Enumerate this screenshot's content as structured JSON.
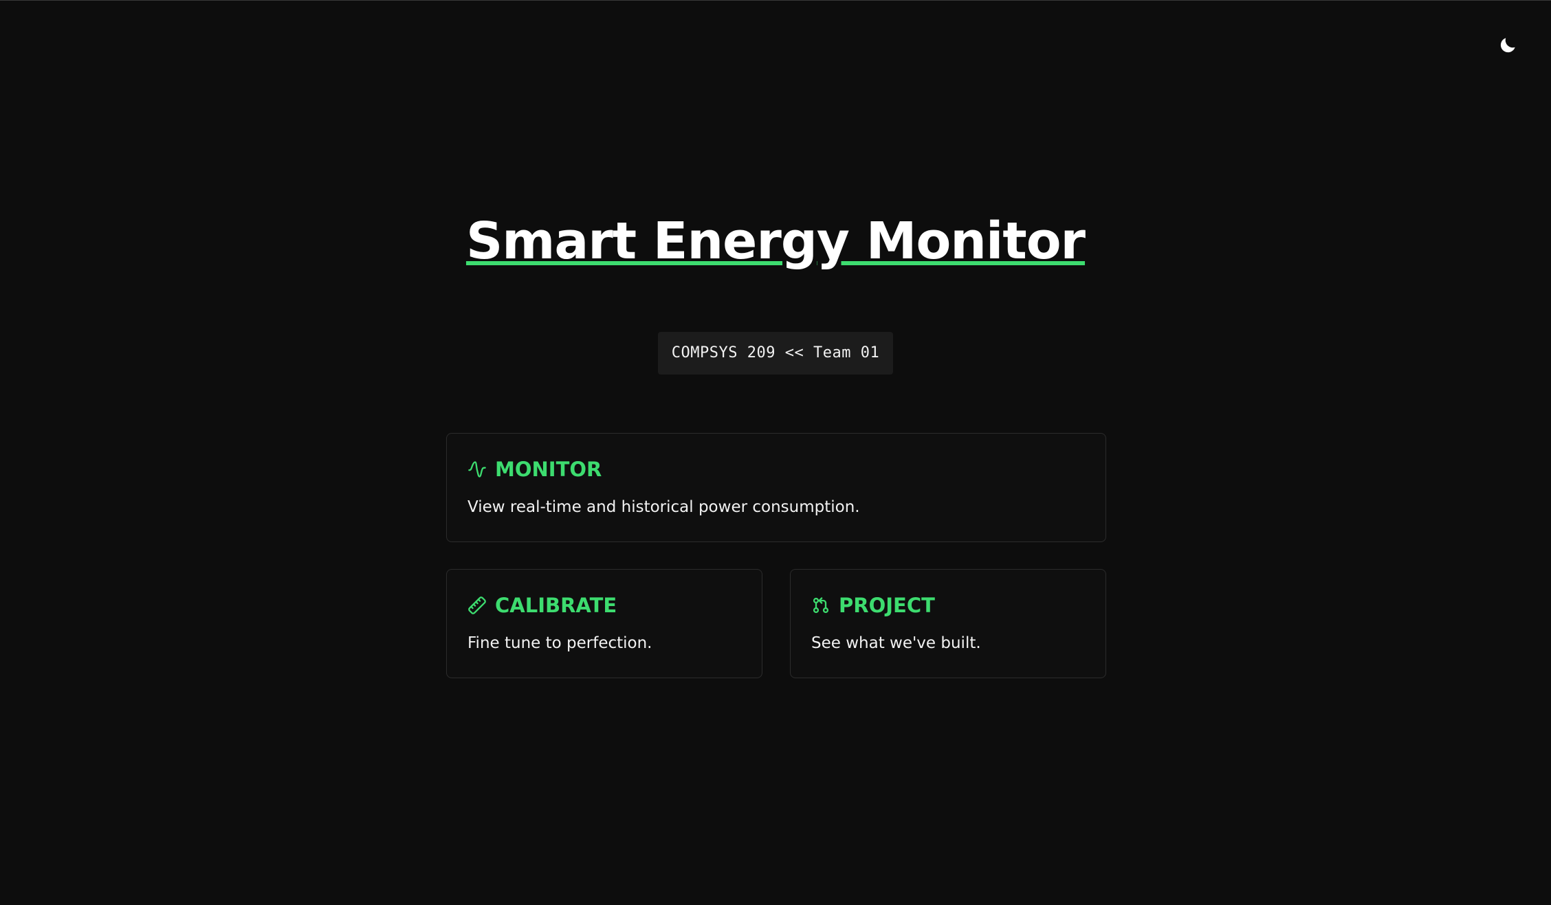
{
  "header": {
    "theme_toggle_icon": "moon-icon"
  },
  "hero": {
    "title": "Smart Energy Monitor",
    "badge": "COMPSYS 209 << Team 01"
  },
  "cards": {
    "monitor": {
      "icon": "activity-icon",
      "title": "MONITOR",
      "description": "View real-time and historical power consumption."
    },
    "calibrate": {
      "icon": "ruler-icon",
      "title": "CALIBRATE",
      "description": "Fine tune to perfection."
    },
    "project": {
      "icon": "git-pull-request-icon",
      "title": "PROJECT",
      "description": "See what we've built."
    }
  },
  "colors": {
    "background": "#0d0d0d",
    "accent": "#3ddc6f",
    "text": "#ffffff",
    "card_border": "#2c2c2c",
    "badge_bg": "#1c1c1c"
  }
}
